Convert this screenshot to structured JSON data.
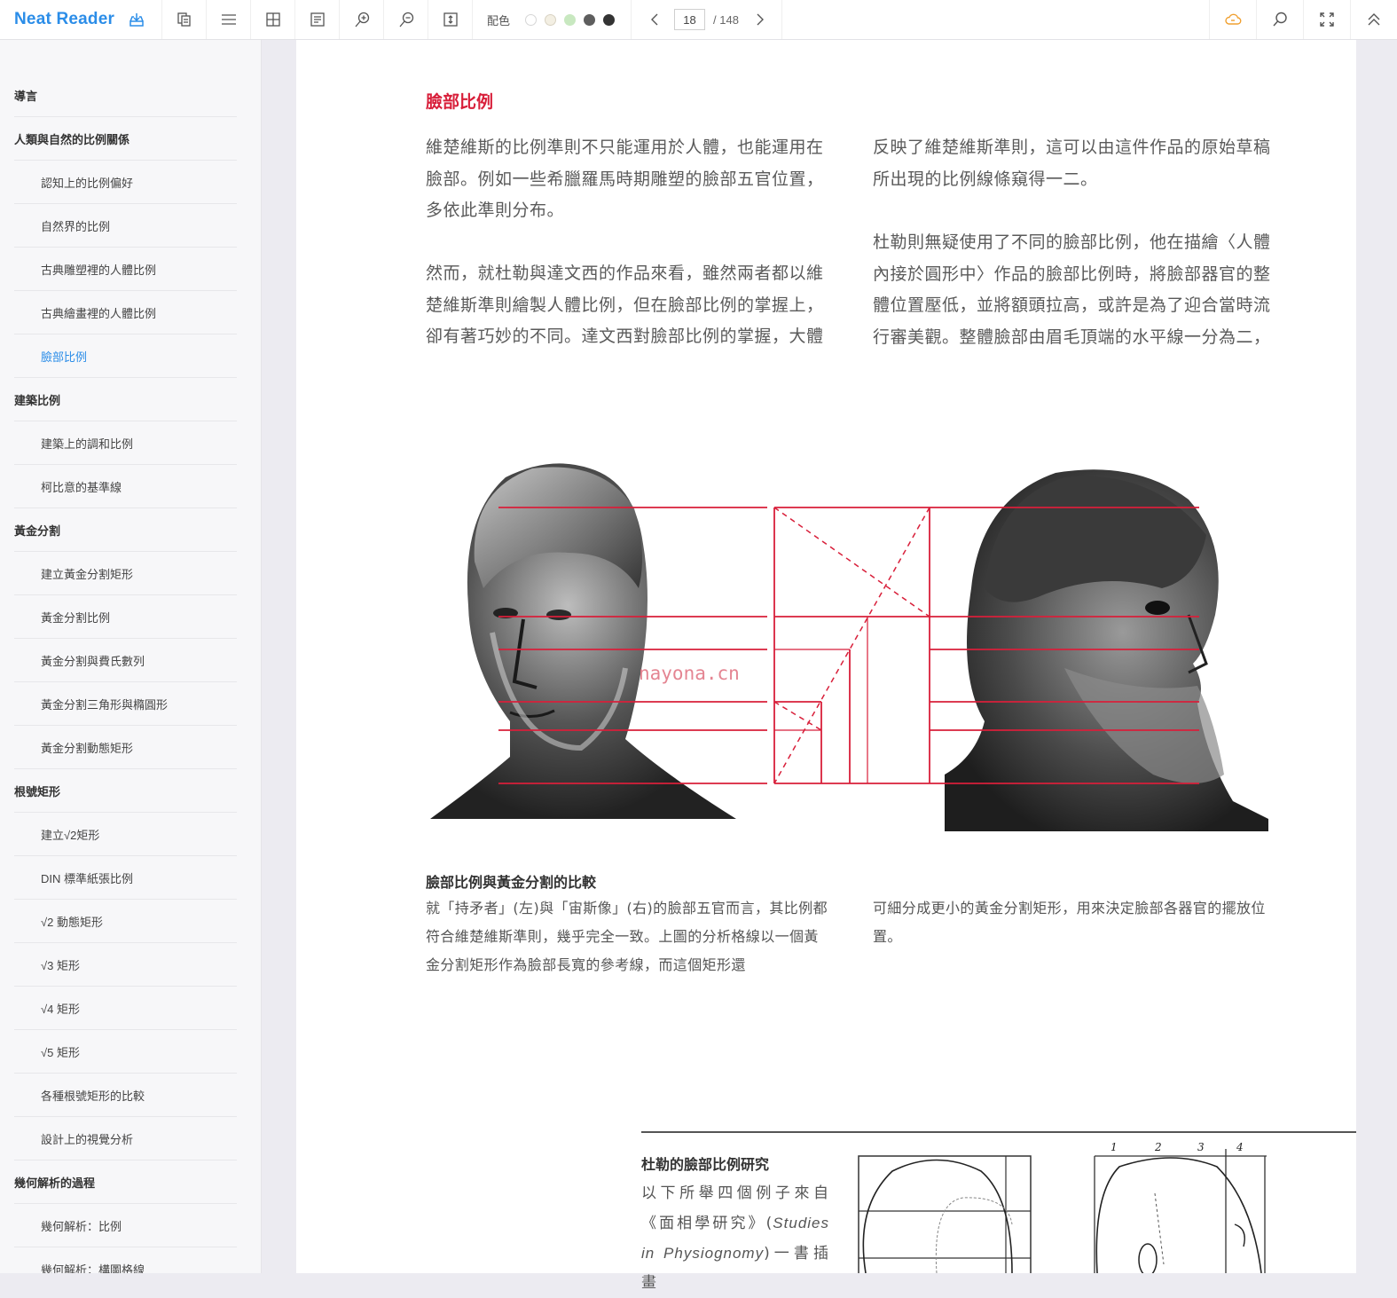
{
  "app": {
    "name": "Neat Reader"
  },
  "toolbar": {
    "buttons": [
      {
        "name": "import-icon"
      },
      {
        "name": "copy-icon"
      },
      {
        "name": "menu-icon"
      },
      {
        "name": "grid-icon"
      },
      {
        "name": "notes-icon"
      },
      {
        "name": "zoom-in-icon"
      },
      {
        "name": "zoom-out-icon"
      },
      {
        "name": "fit-height-icon"
      }
    ],
    "color_scheme_label": "配色",
    "color_swatches": [
      "#ffffff",
      "#f3efe3",
      "#c8e8c0",
      "#5e5e5e",
      "#333333"
    ],
    "current_page": "18",
    "total_pages": "/ 148",
    "right_buttons": [
      "cloud-sync-icon",
      "search-icon",
      "fullscreen-icon",
      "collapse-up-icon"
    ],
    "accent_color": "#2b8de8",
    "cloud_color": "#f0a030"
  },
  "sidebar": {
    "items": [
      {
        "label": "導言",
        "level": 1
      },
      {
        "label": "人類與自然的比例關係",
        "level": 1
      },
      {
        "label": "認知上的比例偏好",
        "level": 2
      },
      {
        "label": "自然界的比例",
        "level": 2
      },
      {
        "label": "古典雕塑裡的人體比例",
        "level": 2
      },
      {
        "label": "古典繪畫裡的人體比例",
        "level": 2
      },
      {
        "label": "臉部比例",
        "level": 2,
        "active": true
      },
      {
        "label": "建築比例",
        "level": 1
      },
      {
        "label": "建築上的調和比例",
        "level": 2
      },
      {
        "label": "柯比意的基準線",
        "level": 2
      },
      {
        "label": "黃金分割",
        "level": 1
      },
      {
        "label": "建立黃金分割矩形",
        "level": 2
      },
      {
        "label": "黃金分割比例",
        "level": 2
      },
      {
        "label": "黃金分割與費氏數列",
        "level": 2
      },
      {
        "label": "黃金分割三角形與橢圓形",
        "level": 2
      },
      {
        "label": "黃金分割動態矩形",
        "level": 2
      },
      {
        "label": "根號矩形",
        "level": 1
      },
      {
        "label": "建立√2矩形",
        "level": 2
      },
      {
        "label": "DIN 標準紙張比例",
        "level": 2
      },
      {
        "label": "√2 動態矩形",
        "level": 2
      },
      {
        "label": "√3 矩形",
        "level": 2
      },
      {
        "label": "√4 矩形",
        "level": 2
      },
      {
        "label": "√5 矩形",
        "level": 2
      },
      {
        "label": "各種根號矩形的比較",
        "level": 2
      },
      {
        "label": "設計上的視覺分析",
        "level": 2
      },
      {
        "label": "幾何解析的過程",
        "level": 1
      },
      {
        "label": "幾何解析：比例",
        "level": 2
      },
      {
        "label": "幾何解析：構圖格線",
        "level": 2
      }
    ]
  },
  "page": {
    "heading": "臉部比例",
    "left_col": {
      "p1": "維楚維斯的比例準則不只能運用於人體，也能運用在臉部。例如一些希臘羅馬時期雕塑的臉部五官位置，多依此準則分布。",
      "p2": "然而，就杜勒與達文西的作品來看，雖然兩者都以維楚維斯準則繪製人體比例，但在臉部比例的掌握上，卻有著巧妙的不同。達文西對臉部比例的掌握，大體"
    },
    "right_col": {
      "p1": "反映了維楚維斯準則，這可以由這件作品的原始草稿所出現的比例線條窺得一二。",
      "p2": "杜勒則無疑使用了不同的臉部比例，他在描繪〈人體內接於圓形中〉作品的臉部比例時，將臉部器官的整體位置壓低，並將額頭拉高，或許是為了迎合當時流行審美觀。整體臉部由眉毛頂端的水平線一分為二，"
    },
    "figure": {
      "watermark": "nayona.cn",
      "line_color": "#d81f3a"
    },
    "caption": {
      "title": "臉部比例與黃金分割的比較",
      "left": "就「持矛者」(左)與「宙斯像」(右)的臉部五官而言，其比例都符合維楚維斯準則，幾乎完全一致。上圖的分析格線以一個黃金分割矩形作為臉部長寬的參考線，而這個矩形還",
      "right": "可細分成更小的黃金分割矩形，用來決定臉部各器官的擺放位置。"
    },
    "sidebar_box": {
      "title": "杜勒的臉部比例研究",
      "body_prefix": "以下所舉四個例子來自《面相學研究》(",
      "body_italic": "Studies in Physiognomy",
      "body_suffix": ")一書插畫",
      "sketch_numbers": [
        "1",
        "2",
        "3",
        "4"
      ]
    }
  }
}
